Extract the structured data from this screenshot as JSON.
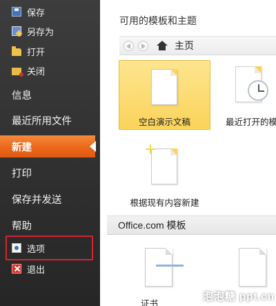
{
  "sidebar": {
    "commands": [
      {
        "label": "保存",
        "icon": "save-icon"
      },
      {
        "label": "另存为",
        "icon": "save-as-icon"
      },
      {
        "label": "打开",
        "icon": "open-folder-icon"
      },
      {
        "label": "关闭",
        "icon": "close-file-icon"
      }
    ],
    "tabs": [
      {
        "label": "信息"
      },
      {
        "label": "最近所用文件"
      },
      {
        "label": "新建",
        "active": true
      },
      {
        "label": "打印"
      },
      {
        "label": "保存并发送"
      },
      {
        "label": "帮助"
      }
    ],
    "bottom": [
      {
        "label": "选项",
        "icon": "options-icon",
        "highlighted": true
      },
      {
        "label": "退出",
        "icon": "exit-icon"
      }
    ],
    "active_color": "#ec6a1c",
    "highlight_color": "#d4252f"
  },
  "main": {
    "section_title": "可用的模板和主题",
    "nav": {
      "home_label": "主页"
    },
    "tiles": [
      {
        "caption": "空白演示文稿",
        "selected": true
      },
      {
        "caption": "最近打开的模"
      },
      {
        "caption": "根据现有内容新建"
      }
    ],
    "office_section": {
      "title": "Office.com 模板",
      "items": [
        {
          "caption": "证书"
        }
      ]
    }
  },
  "watermark": "泡泡糖 ppt.cn"
}
